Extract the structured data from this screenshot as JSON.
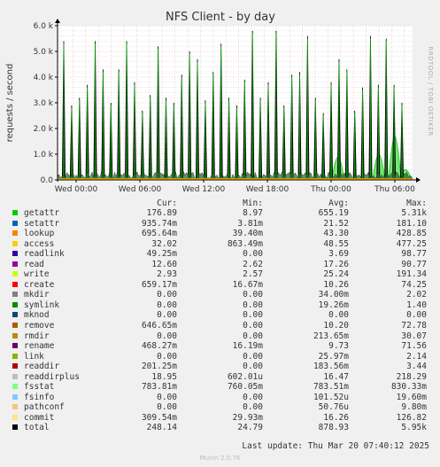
{
  "chart_data": {
    "type": "line",
    "title": "NFS Client - by day",
    "ylabel": "requests / second",
    "ylim": [
      0,
      6000
    ],
    "y_ticks": [
      "0.0",
      "1.0 k",
      "2.0 k",
      "3.0 k",
      "4.0 k",
      "5.0 k",
      "6.0 k"
    ],
    "x_ticks": [
      "Wed 00:00",
      "Wed 06:00",
      "Wed 12:00",
      "Wed 18:00",
      "Thu 00:00",
      "Thu 06:00"
    ],
    "side_text": "RRDTOOL / TOBI OETIKER",
    "grid": true,
    "spike_heights": [
      5400,
      2900,
      3200,
      3700,
      5400,
      4300,
      3000,
      4300,
      5400,
      3800,
      2700,
      3300,
      5200,
      3200,
      3000,
      4100,
      5000,
      4700,
      3100,
      4200,
      5300,
      3200,
      2900,
      3900,
      5800,
      3200,
      3800,
      5800,
      2900,
      4100,
      4200,
      5600,
      3200,
      2600,
      3800,
      4700,
      4300,
      2700,
      3600,
      5600,
      3700,
      5500,
      3700,
      3000
    ],
    "green_bumps": [
      {
        "x": 0.79,
        "value": 900
      },
      {
        "x": 0.905,
        "value": 1000
      },
      {
        "x": 0.95,
        "value": 1700
      },
      {
        "x": 0.98,
        "value": 400
      }
    ],
    "legend_headers": {
      "cur": "Cur:",
      "min": "Min:",
      "avg": "Avg:",
      "max": "Max:"
    },
    "series": [
      {
        "name": "getattr",
        "color": "#00cc00",
        "cur": "176.89",
        "min": "8.97",
        "avg": "655.19",
        "max": "5.31k"
      },
      {
        "name": "setattr",
        "color": "#0066b3",
        "cur": "935.74m",
        "min": "3.81m",
        "avg": "21.52",
        "max": "181.10"
      },
      {
        "name": "lookup",
        "color": "#ff8000",
        "cur": "695.64m",
        "min": "39.40m",
        "avg": "43.30",
        "max": "428.85"
      },
      {
        "name": "access",
        "color": "#ffcc00",
        "cur": "32.02",
        "min": "863.49m",
        "avg": "48.55",
        "max": "477.25"
      },
      {
        "name": "readlink",
        "color": "#330099",
        "cur": "49.25m",
        "min": "0.00",
        "avg": "3.69",
        "max": "98.77"
      },
      {
        "name": "read",
        "color": "#990099",
        "cur": "12.60",
        "min": "2.62",
        "avg": "17.26",
        "max": "90.77"
      },
      {
        "name": "write",
        "color": "#ccff00",
        "cur": "2.93",
        "min": "2.57",
        "avg": "25.24",
        "max": "191.34"
      },
      {
        "name": "create",
        "color": "#ff0000",
        "cur": "659.17m",
        "min": "16.67m",
        "avg": "10.26",
        "max": "74.25"
      },
      {
        "name": "mkdir",
        "color": "#808080",
        "cur": "0.00",
        "min": "0.00",
        "avg": "34.00m",
        "max": "2.02"
      },
      {
        "name": "symlink",
        "color": "#008f00",
        "cur": "0.00",
        "min": "0.00",
        "avg": "19.26m",
        "max": "1.40"
      },
      {
        "name": "mknod",
        "color": "#00487d",
        "cur": "0.00",
        "min": "0.00",
        "avg": "0.00",
        "max": "0.00"
      },
      {
        "name": "remove",
        "color": "#b35a00",
        "cur": "646.65m",
        "min": "0.00",
        "avg": "10.20",
        "max": "72.78"
      },
      {
        "name": "rmdir",
        "color": "#b38f00",
        "cur": "0.00",
        "min": "0.00",
        "avg": "213.65m",
        "max": "30.07"
      },
      {
        "name": "rename",
        "color": "#6b006b",
        "cur": "468.27m",
        "min": "16.19m",
        "avg": "9.73",
        "max": "71.56"
      },
      {
        "name": "link",
        "color": "#8fb300",
        "cur": "0.00",
        "min": "0.00",
        "avg": "25.97m",
        "max": "2.14"
      },
      {
        "name": "readdir",
        "color": "#b30000",
        "cur": "201.25m",
        "min": "0.00",
        "avg": "183.56m",
        "max": "3.44"
      },
      {
        "name": "readdirplus",
        "color": "#bebebe",
        "cur": "18.95",
        "min": "602.01u",
        "avg": "16.47",
        "max": "218.29"
      },
      {
        "name": "fsstat",
        "color": "#80ff80",
        "cur": "783.81m",
        "min": "760.05m",
        "avg": "783.51m",
        "max": "830.33m"
      },
      {
        "name": "fsinfo",
        "color": "#80c9ff",
        "cur": "0.00",
        "min": "0.00",
        "avg": "101.52u",
        "max": "19.60m"
      },
      {
        "name": "pathconf",
        "color": "#ffc080",
        "cur": "0.00",
        "min": "0.00",
        "avg": "50.76u",
        "max": "9.80m"
      },
      {
        "name": "commit",
        "color": "#ffe680",
        "cur": "309.54m",
        "min": "29.93m",
        "avg": "16.26",
        "max": "126.82"
      },
      {
        "name": "total",
        "color": "#000000",
        "cur": "248.14",
        "min": "24.79",
        "avg": "878.93",
        "max": "5.95k"
      }
    ]
  },
  "footer": {
    "last_update": "Last update: Thu Mar 20 07:40:12 2025",
    "munin": "Munin 2.0.76"
  }
}
